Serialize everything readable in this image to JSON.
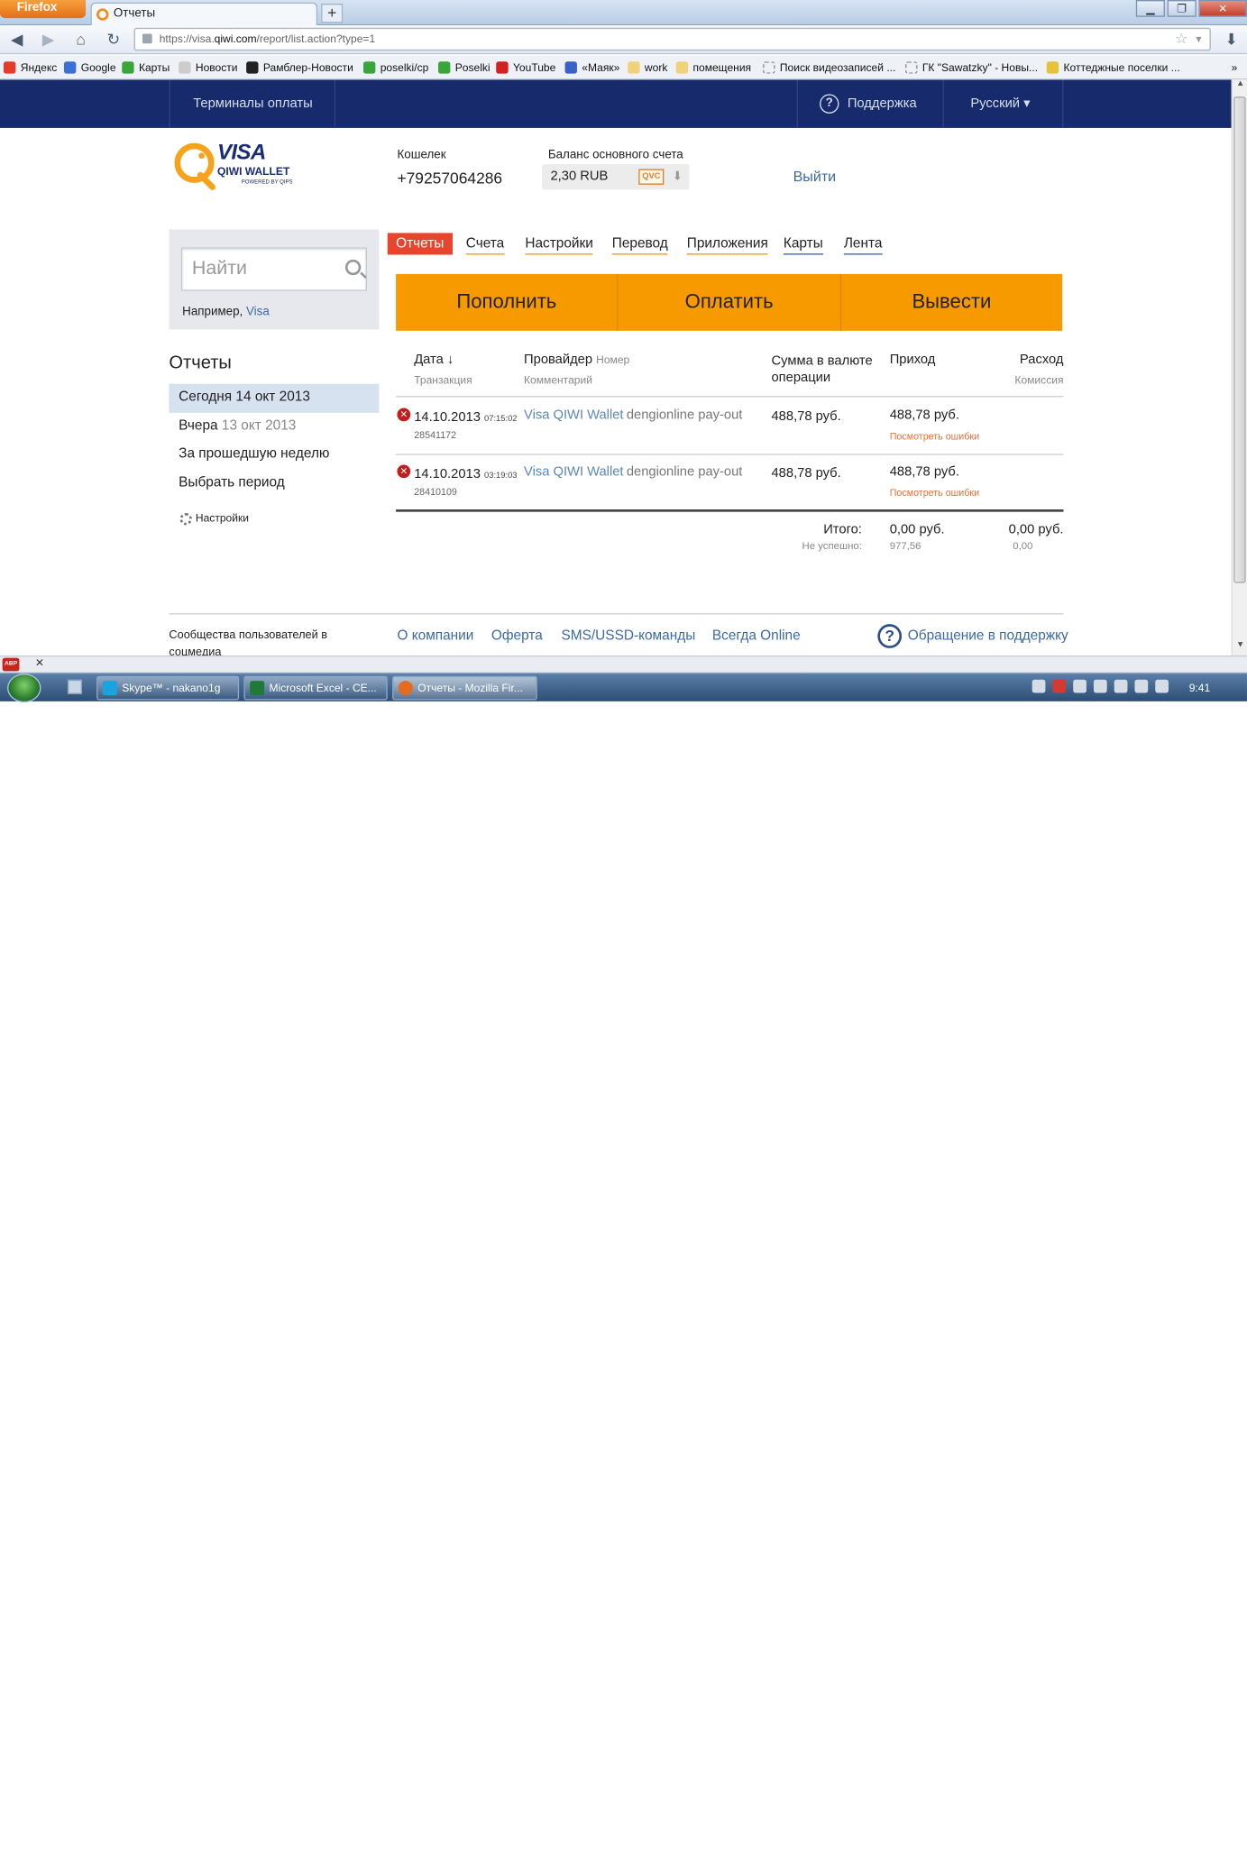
{
  "browser": {
    "menu_button": "Firefox",
    "tab_title": "Отчеты",
    "new_tab": "+",
    "url_prefix": "https://visa.",
    "url_host": "qiwi.com",
    "url_path": "/report/list.action?type=1",
    "bookmarks": [
      "Яндекс",
      "Google",
      "Карты",
      "Новости",
      "Рамблер-Новости",
      "poselki/cp",
      "Poselki",
      "YouTube",
      "«Маяк»",
      "work",
      "помещения",
      "Поиск видеозаписей ...",
      "ГК \"Sawatzky\" - Новы...",
      "Коттеджные поселки ..."
    ]
  },
  "topnav": {
    "terminals": "Терминалы оплаты",
    "support": "Поддержка",
    "language": "Русский ▾"
  },
  "header": {
    "logo_visa": "VISA",
    "logo_qiwi": "QIWI WALLET",
    "logo_powered": "POWERED BY QIPS",
    "wallet_label": "Кошелек",
    "wallet_number": "+79257064286",
    "balance_label": "Баланс основного счета",
    "balance_value": "2,30 RUB",
    "balance_badge": "QVC",
    "exit": "Выйти"
  },
  "search": {
    "placeholder": "Найти",
    "example_prefix": "Например, ",
    "example_link": "Visa"
  },
  "tabs": [
    "Отчеты",
    "Счета",
    "Настройки",
    "Перевод",
    "Приложения",
    "Карты",
    "Лента"
  ],
  "actions": [
    "Пополнить",
    "Оплатить",
    "Вывести"
  ],
  "sidebar": {
    "title": "Отчеты",
    "items": [
      {
        "label": "Сегодня 14 окт 2013",
        "dim": ""
      },
      {
        "label": "Вчера ",
        "dim": "13 окт 2013"
      },
      {
        "label": "За прошедшую неделю",
        "dim": ""
      },
      {
        "label": "Выбрать период",
        "dim": ""
      }
    ],
    "settings": "Настройки"
  },
  "table": {
    "headers": {
      "date": "Дата ↓",
      "date_sub": "Транзакция",
      "provider": "Провайдер",
      "provider_num": "Номер",
      "provider_sub": "Комментарий",
      "sum": "Сумма в валюте операции",
      "income": "Приход",
      "expense": "Расход",
      "expense_sub": "Комиссия"
    },
    "rows": [
      {
        "date": "14.10.2013",
        "time": "07:15:02",
        "txn": "28541172",
        "provider": "Visa QIWI Wallet",
        "comment": "dengionline pay-out",
        "sum": "488,78 руб.",
        "income": "488,78 руб.",
        "error_link": "Посмотреть ошибки"
      },
      {
        "date": "14.10.2013",
        "time": "03:19:03",
        "txn": "28410109",
        "provider": "Visa QIWI Wallet",
        "comment": "dengionline pay-out",
        "sum": "488,78 руб.",
        "income": "488,78 руб.",
        "error_link": "Посмотреть ошибки"
      }
    ],
    "total_label": "Итого:",
    "failed_label": "Не успешно:",
    "total_income": "0,00 руб.",
    "failed_income": "977,56",
    "total_expense": "0,00 руб.",
    "failed_expense": "0,00"
  },
  "footer": {
    "communities": "Сообщества пользователей в соцмедиа",
    "links": [
      "О компании",
      "Оферта",
      "SMS/USSD-команды",
      "Всегда Online"
    ],
    "support": "Обращение в поддержку"
  },
  "taskbar": {
    "buttons": [
      "Skype™ - nakano1g",
      "Microsoft Excel - CE...",
      "Отчеты - Mozilla Fir..."
    ],
    "clock": "9:41"
  },
  "colors": {
    "nav_bg": "#172a6b",
    "accent_orange": "#f79a00",
    "active_tab": "#e8442e",
    "link": "#3a6aa5",
    "error": "#c41b1b"
  }
}
